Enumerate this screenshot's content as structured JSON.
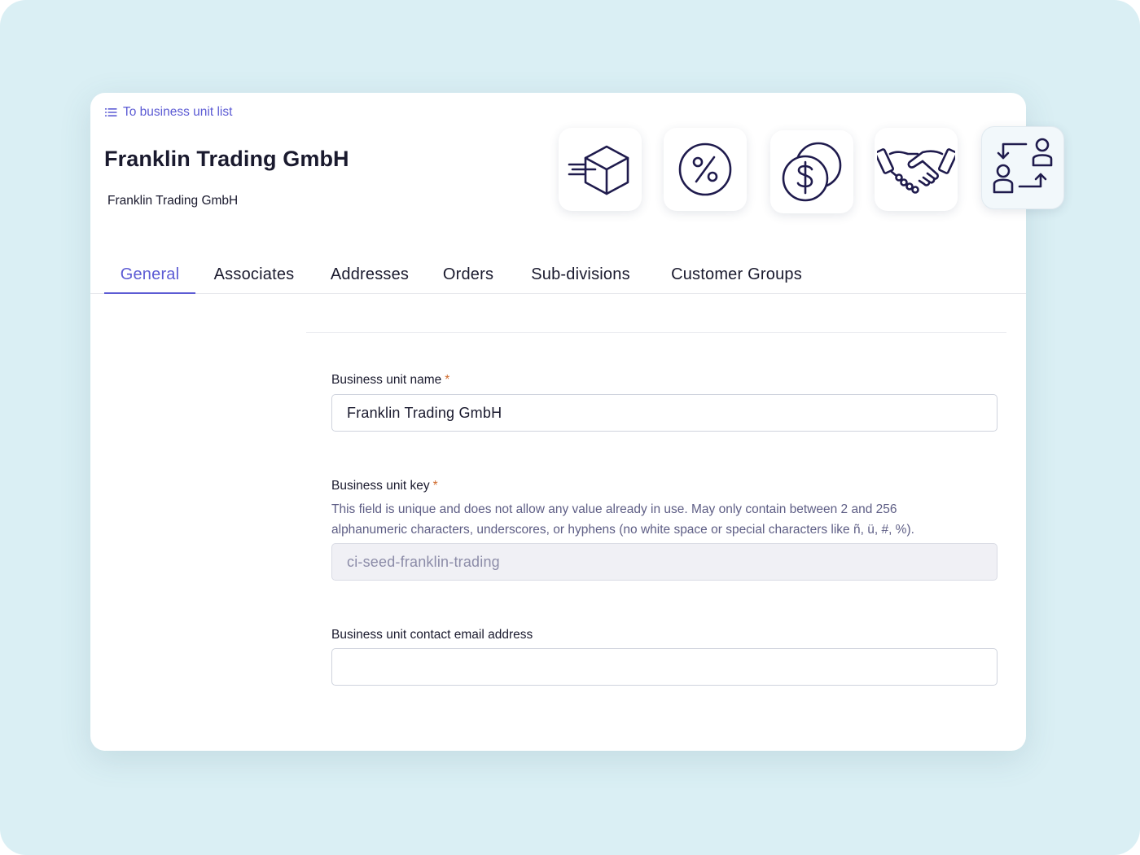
{
  "nav": {
    "back_link": "To business unit list"
  },
  "header": {
    "title": "Franklin Trading GmbH",
    "subtitle": "Franklin Trading GmbH"
  },
  "feature_icons": [
    "box-delivery-icon",
    "percent-icon",
    "dollar-coins-icon",
    "handshake-icon",
    "user-exchange-icon"
  ],
  "tabs": {
    "items": [
      "General",
      "Associates",
      "Addresses",
      "Orders",
      "Sub-divisions",
      "Customer Groups"
    ],
    "active": "General"
  },
  "form": {
    "name": {
      "label": "Business unit name",
      "required_marker": "*",
      "value": "Franklin Trading GmbH"
    },
    "key": {
      "label": "Business unit key",
      "required_marker": "*",
      "description_line1": "This field is unique and does not allow any value already in use. May only contain between 2 and 256",
      "description_line2": "alphanumeric characters, underscores, or hyphens (no white space or special characters like ñ, ü, #, %).",
      "value": "ci-seed-franklin-trading"
    },
    "email": {
      "label": "Business unit contact email address",
      "value": ""
    }
  },
  "colors": {
    "accent": "#5c5bd4",
    "required": "#d06c2f",
    "icon_stroke": "#1f1b4d",
    "backdrop": "#daeff4"
  }
}
